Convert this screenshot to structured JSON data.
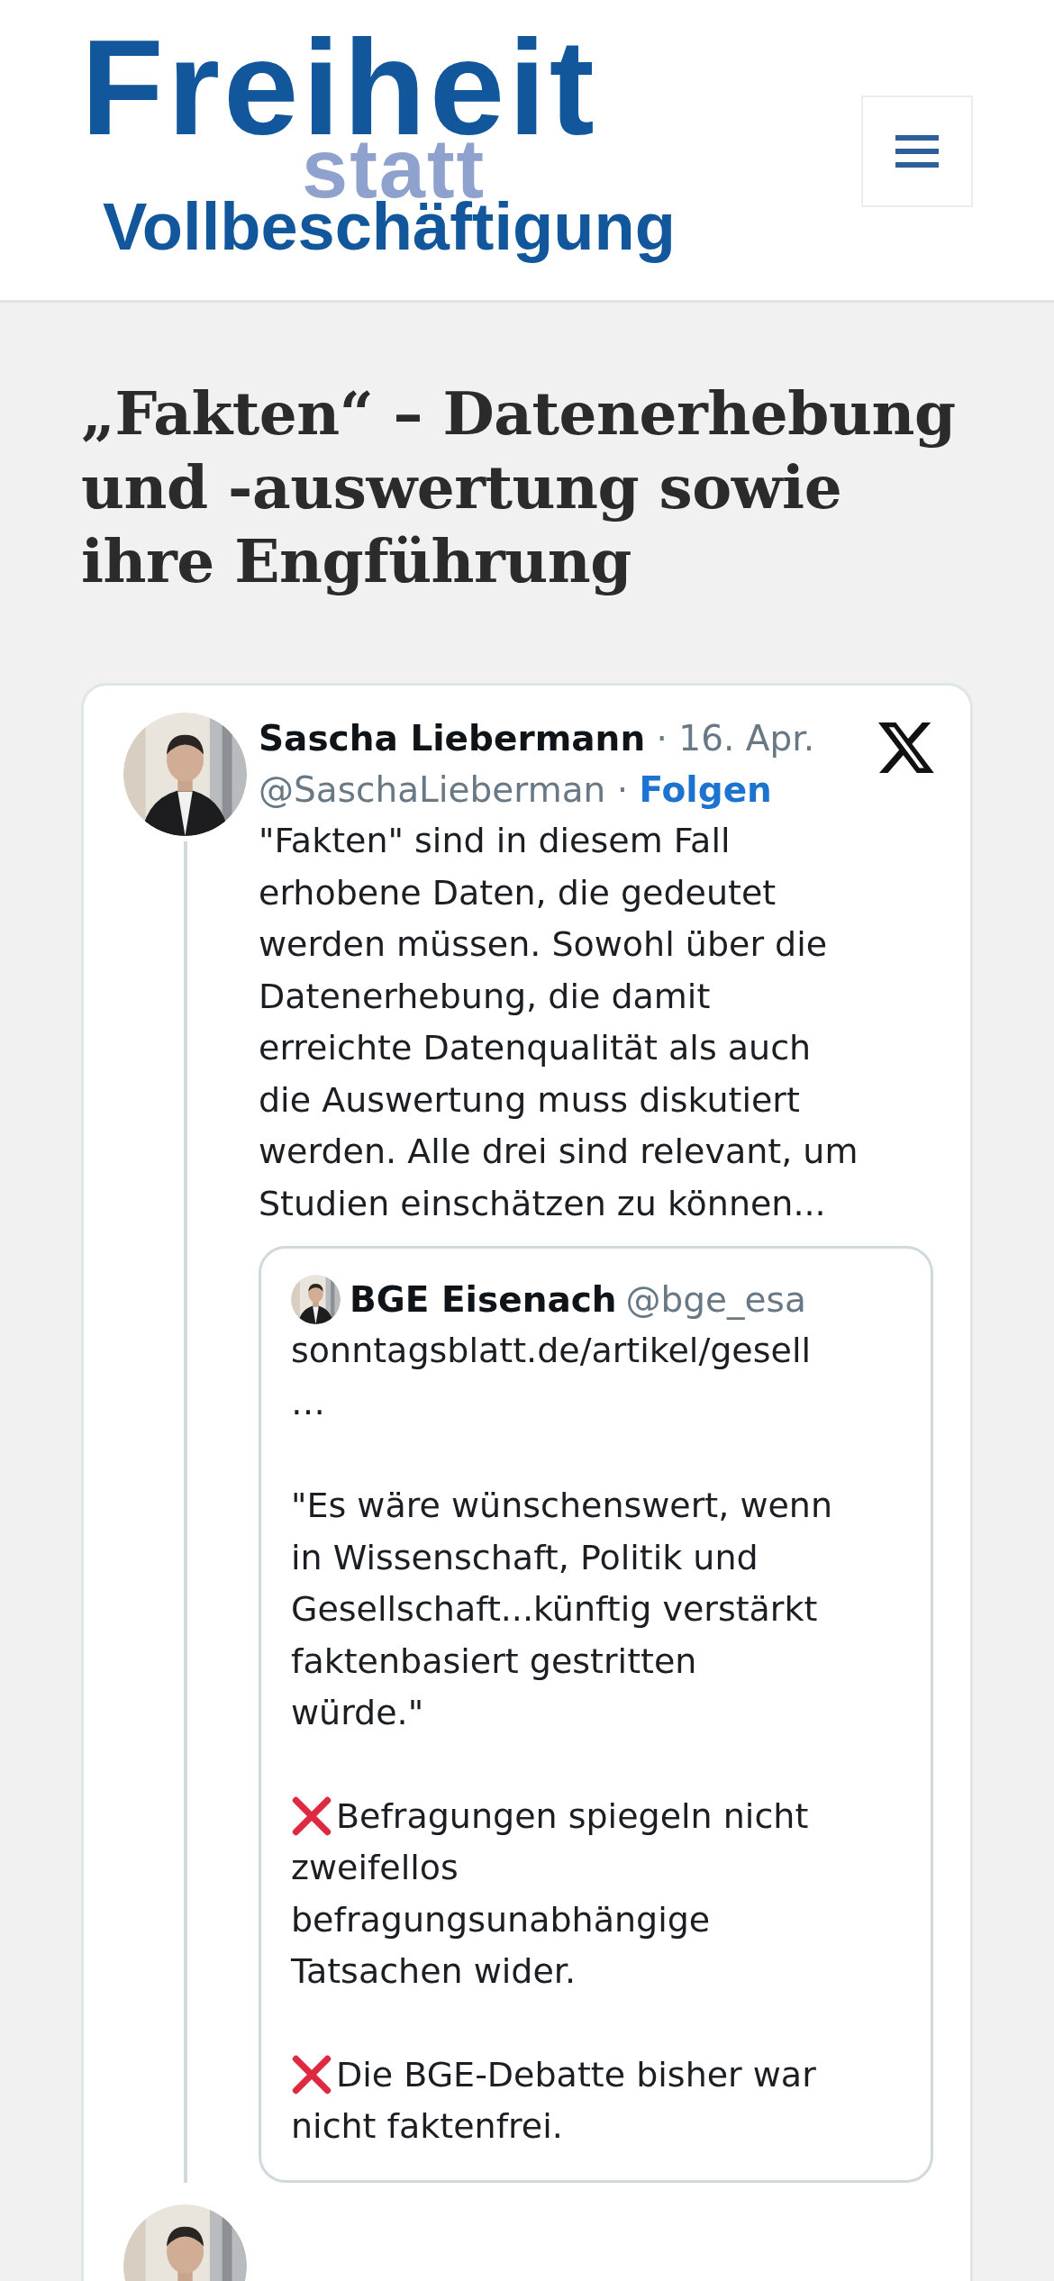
{
  "header": {
    "logo": {
      "line_1": "Freiheit",
      "line_2": "statt",
      "line_3": "Vollbeschäftigung"
    },
    "menu_button": {
      "kind": "hamburger"
    }
  },
  "article": {
    "title": "„Fakten“ – Datenerhebung und -auswertung sowie ihre Engführung",
    "embedded_post": {
      "author": "Sascha Liebermann",
      "date": "· 16. Apr.",
      "handle": "@SaschaLieberman",
      "separator": "·",
      "follow": "Folgen",
      "text_lines": [
        "\"Fakten\" sind in diesem Fall",
        "erhobene Daten, die gedeutet",
        "werden müssen. Sowohl über die",
        "Datenerhebung, die damit",
        "erreichte Datenqualität als auch",
        "die Auswertung muss diskutiert",
        "werden. Alle drei sind relevant, um",
        "Studien einschätzen zu können..."
      ],
      "quoted_post": {
        "author": "BGE Eisenach",
        "handle": "@bge_esa",
        "paragraphs": [
          {
            "kind": "plain",
            "lines": [
              "sonntagsblatt.de/artikel/gesell",
              "…"
            ]
          },
          {
            "kind": "plain",
            "lines": [
              "\"Es wäre wünschenswert, wenn",
              "in Wissenschaft, Politik und",
              "Gesellschaft...künftig verstärkt",
              "faktenbasiert gestritten",
              "würde.\""
            ]
          },
          {
            "kind": "cross",
            "lines": [
              "Befragungen spiegeln nicht",
              "zweifellos",
              "befragungsunabhängige",
              "Tatsachen wider."
            ]
          },
          {
            "kind": "cross",
            "lines": [
              "Die BGE-Debatte bisher war",
              "nicht faktenfrei."
            ]
          }
        ]
      }
    }
  }
}
